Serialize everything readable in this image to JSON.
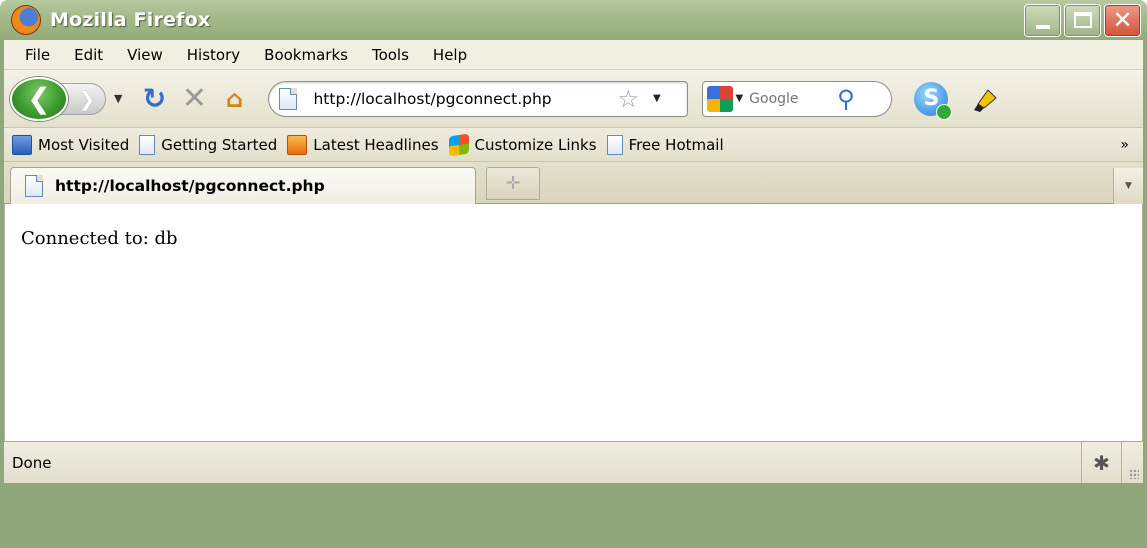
{
  "window": {
    "title": "Mozilla Firefox",
    "close_glyph": "✕"
  },
  "menubar": {
    "items": [
      "File",
      "Edit",
      "View",
      "History",
      "Bookmarks",
      "Tools",
      "Help"
    ]
  },
  "navbar": {
    "url": "http://localhost/pgconnect.php",
    "search_placeholder": "Google"
  },
  "bookmarks": {
    "items": [
      {
        "label": "Most Visited",
        "icon": "most-visited-icon"
      },
      {
        "label": "Getting Started",
        "icon": "page-icon"
      },
      {
        "label": "Latest Headlines",
        "icon": "rss-icon"
      },
      {
        "label": "Customize Links",
        "icon": "windows-icon"
      },
      {
        "label": "Free Hotmail",
        "icon": "page-icon"
      }
    ],
    "overflow": "»"
  },
  "tabs": {
    "active_title": "http://localhost/pgconnect.php"
  },
  "content": {
    "text": "Connected to: db"
  },
  "status": {
    "text": "Done"
  },
  "colors": {
    "frame": "#8fa77a",
    "titlebar": "#a3b98a",
    "chrome": "#e8e5d0",
    "close_button": "#d2543a",
    "back_button": "#3c9c2f"
  }
}
